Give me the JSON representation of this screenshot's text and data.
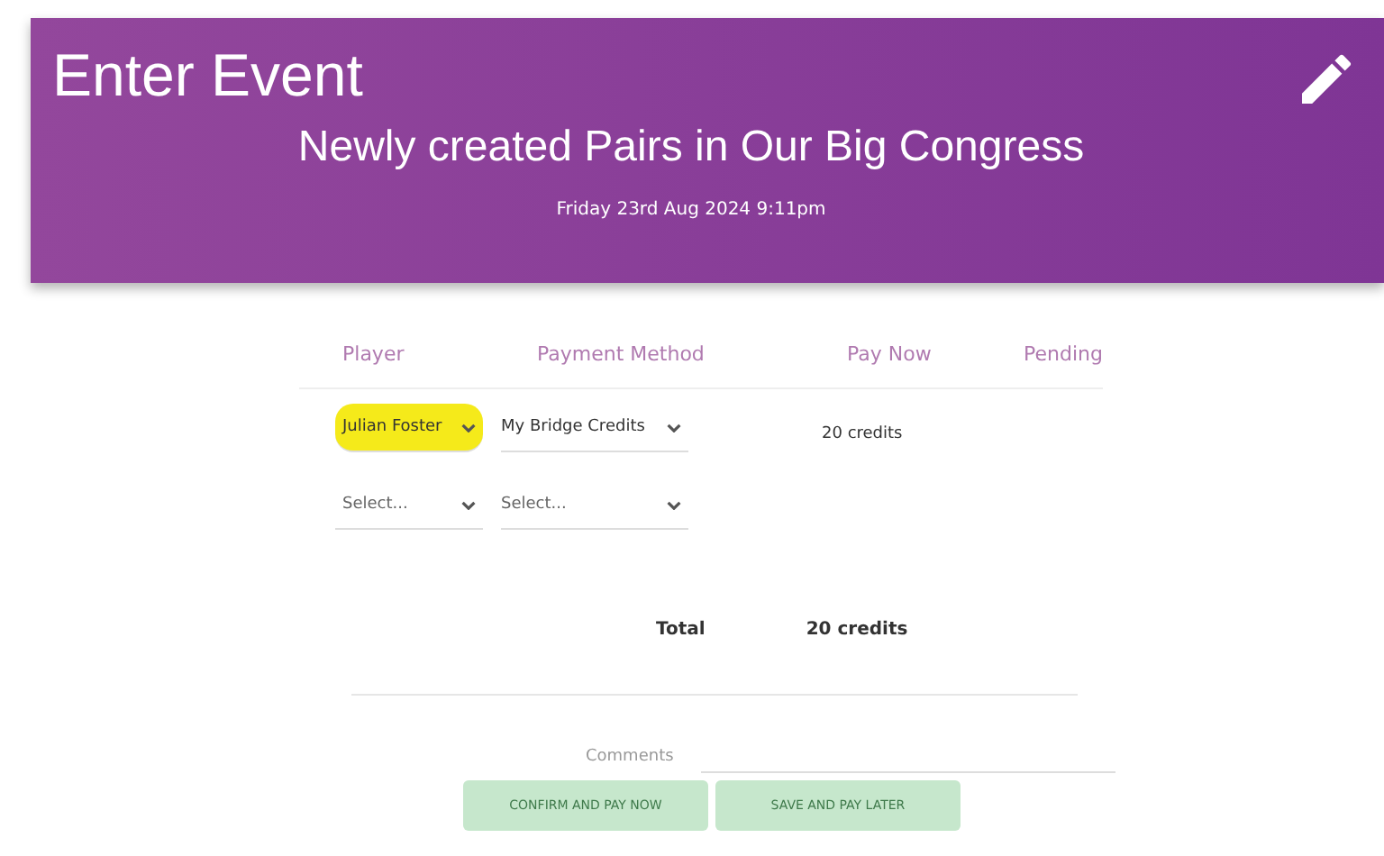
{
  "header": {
    "title": "Enter Event",
    "event_name": "Newly created Pairs in Our Big Congress",
    "date": "Friday 23rd Aug 2024 9:11pm"
  },
  "table": {
    "columns": [
      "Player",
      "Payment Method",
      "Pay Now",
      "Pending"
    ],
    "rows": [
      {
        "player": {
          "value": "Julian Foster",
          "highlighted": true
        },
        "method": {
          "value": "My Bridge Credits"
        },
        "pay_now": "20 credits"
      },
      {
        "player": {
          "placeholder": "Select...",
          "highlighted": false
        },
        "method": {
          "placeholder": "Select..."
        }
      }
    ]
  },
  "total": {
    "label": "Total",
    "value": "20 credits"
  },
  "comments": {
    "label": "Comments"
  },
  "buttons": [
    {
      "label": "CONFIRM AND PAY NOW",
      "disabled": true
    },
    {
      "label": "SAVE AND PAY LATER",
      "disabled": true
    }
  ]
}
